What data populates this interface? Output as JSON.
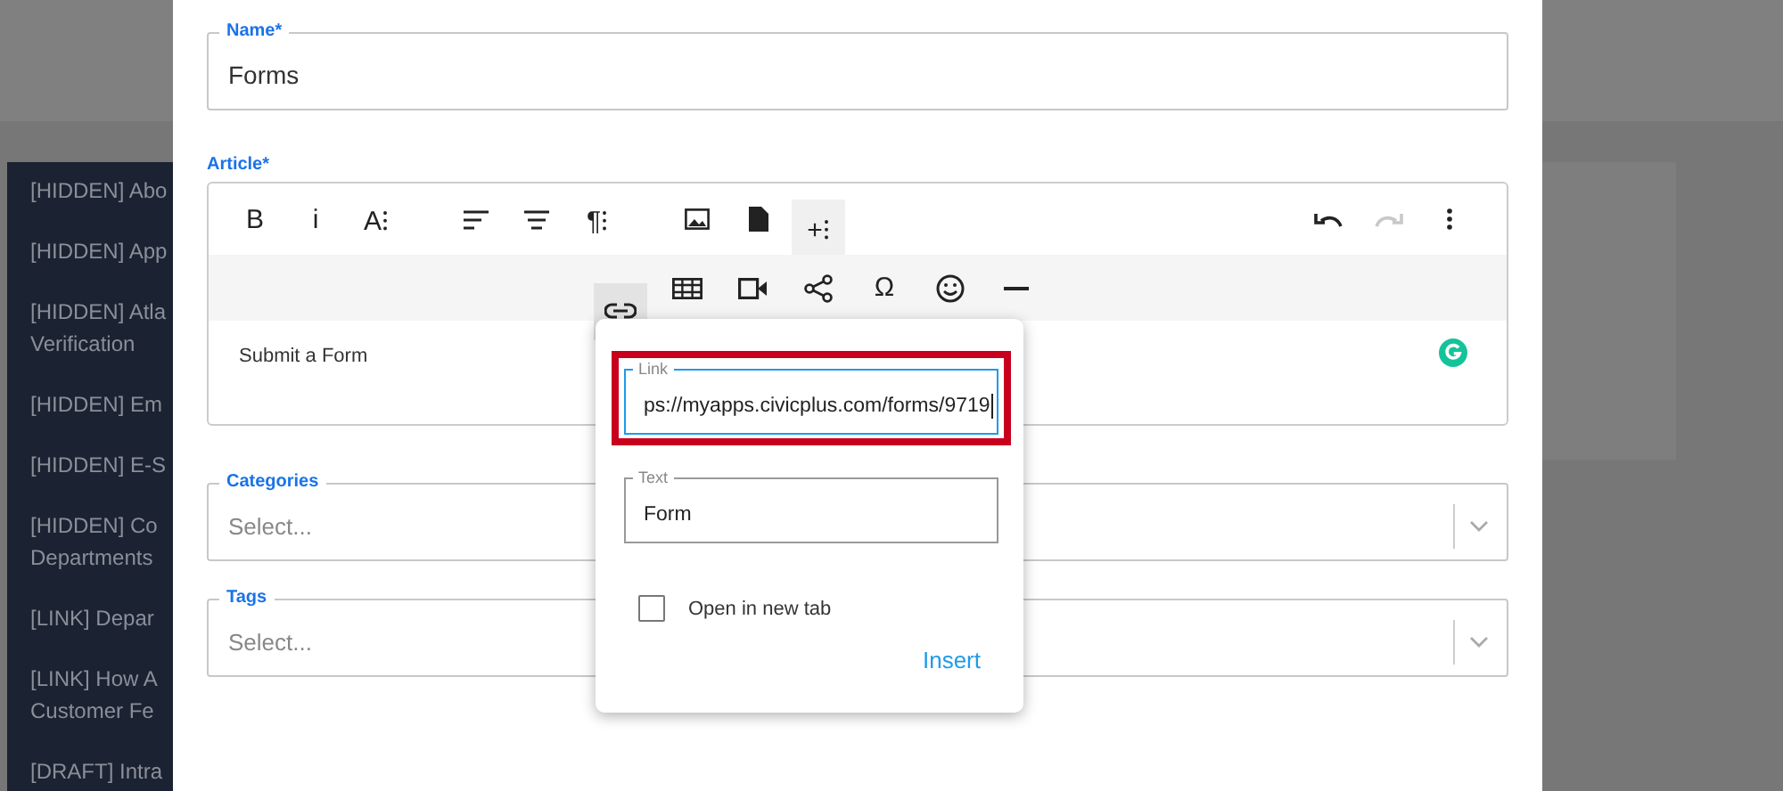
{
  "background": {
    "sidebar_items": [
      {
        "lines": [
          "[HIDDEN] Abo"
        ]
      },
      {
        "lines": [
          "[HIDDEN] App"
        ]
      },
      {
        "lines": [
          "[HIDDEN] Atla",
          "Verification"
        ]
      },
      {
        "lines": [
          "[HIDDEN] Em"
        ]
      },
      {
        "lines": [
          "[HIDDEN] E-S"
        ]
      },
      {
        "lines": [
          "[HIDDEN] Co",
          "Departments"
        ]
      },
      {
        "lines": [
          "[LINK] Depar"
        ]
      },
      {
        "lines": [
          "[LINK] How A",
          "Customer Fe"
        ]
      },
      {
        "lines": [
          "[DRAFT] Intra"
        ]
      }
    ]
  },
  "modal": {
    "name_field": {
      "label": "Name*",
      "value": "Forms"
    },
    "article": {
      "label": "Article*",
      "toolbar_primary": [
        {
          "kind": "glyph",
          "label": "B",
          "selected": false,
          "disabled": false
        },
        {
          "kind": "glyph",
          "label": "i",
          "selected": false,
          "disabled": false
        },
        {
          "kind": "glyph",
          "label": "A⁝",
          "selected": false,
          "disabled": false
        },
        {
          "kind": "align-left",
          "selected": false,
          "disabled": false
        },
        {
          "kind": "align-center",
          "selected": false,
          "disabled": false
        },
        {
          "kind": "glyph",
          "label": "¶⁝",
          "selected": false,
          "disabled": false
        },
        {
          "kind": "image",
          "selected": false,
          "disabled": false
        },
        {
          "kind": "file",
          "selected": false,
          "disabled": false
        },
        {
          "kind": "glyph",
          "label": "+⁝",
          "selected": true,
          "disabled": false
        }
      ],
      "toolbar_end": [
        {
          "kind": "undo",
          "selected": false,
          "disabled": false
        },
        {
          "kind": "redo",
          "selected": false,
          "disabled": true
        },
        {
          "kind": "more",
          "selected": false,
          "disabled": false
        }
      ],
      "toolbar_secondary": [
        {
          "kind": "link",
          "selected": true,
          "disabled": false
        },
        {
          "kind": "table",
          "selected": false,
          "disabled": false
        },
        {
          "kind": "video",
          "selected": false,
          "disabled": false
        },
        {
          "kind": "share",
          "selected": false,
          "disabled": false
        },
        {
          "kind": "glyph",
          "label": "Ω",
          "selected": false,
          "disabled": false
        },
        {
          "kind": "emoji",
          "selected": false,
          "disabled": false
        },
        {
          "kind": "rule",
          "selected": false,
          "disabled": false
        }
      ],
      "content": "Submit a Form"
    },
    "link_popup": {
      "link_field": {
        "label": "Link",
        "value": "ps://myapps.civicplus.com/forms/9719",
        "focused": true,
        "highlighted": true
      },
      "text_field": {
        "label": "Text",
        "value": "Form",
        "focused": false,
        "highlighted": false
      },
      "open_in_new_tab": {
        "label": "Open in new tab",
        "checked": false
      },
      "insert_button": "Insert"
    },
    "categories": {
      "label": "Categories",
      "placeholder": "Select..."
    },
    "tags": {
      "label": "Tags",
      "placeholder": "Select..."
    }
  }
}
